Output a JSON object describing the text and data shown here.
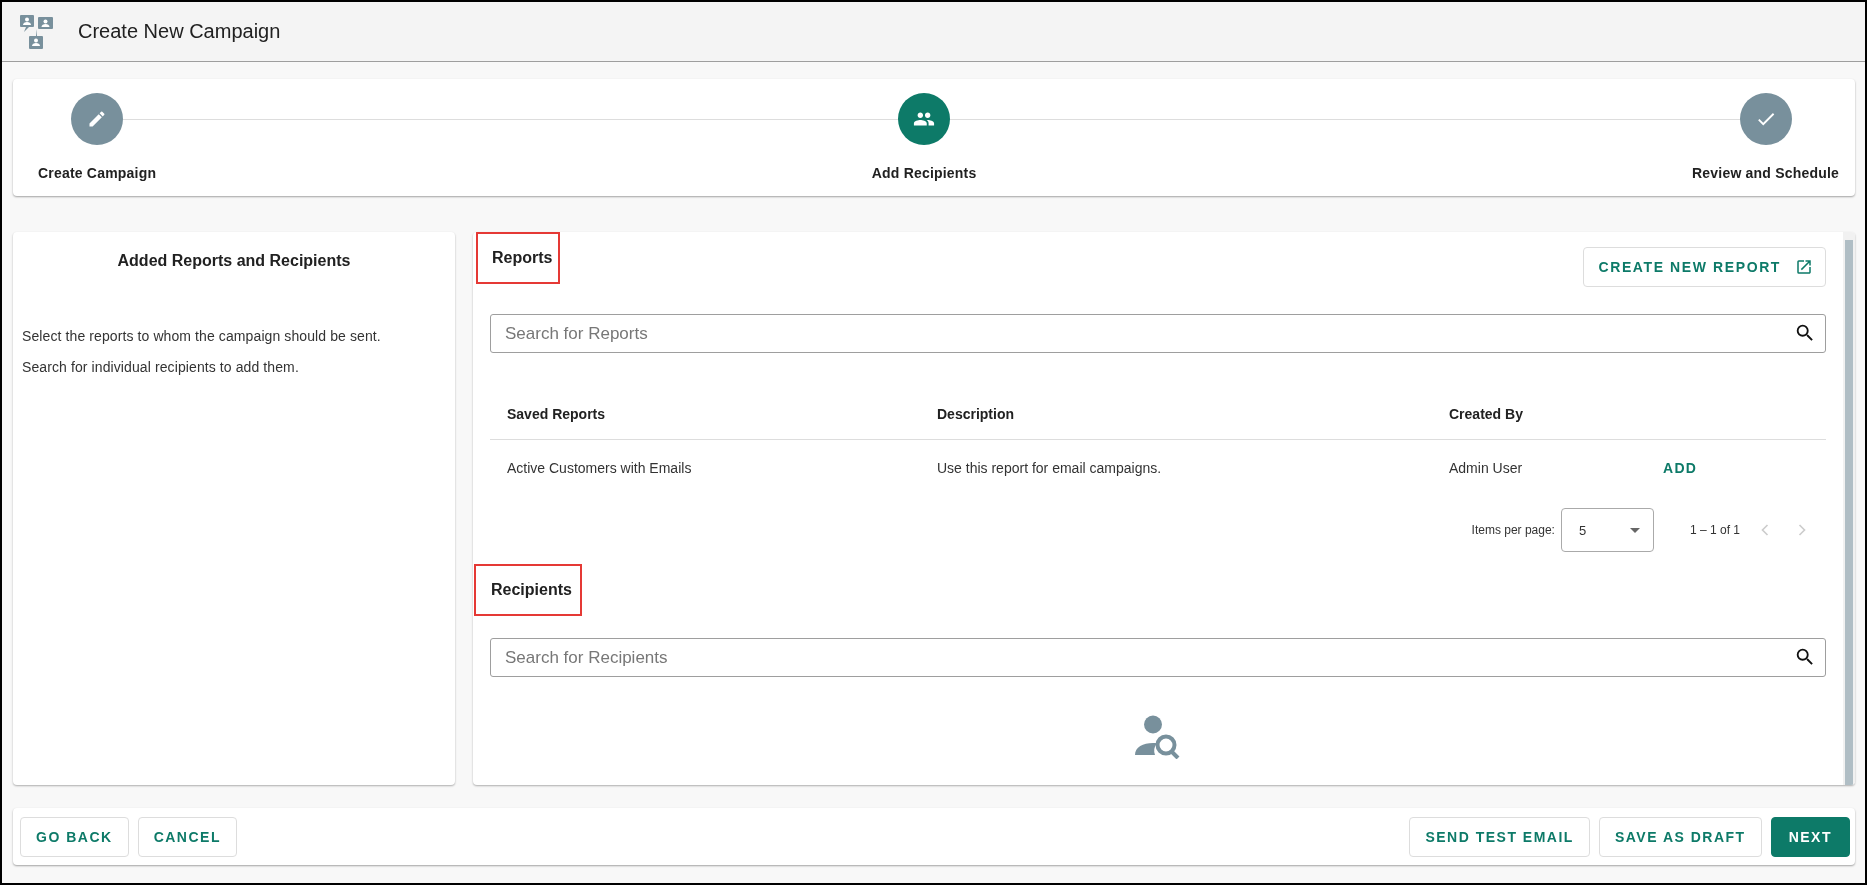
{
  "header": {
    "title": "Create New Campaign"
  },
  "steps": [
    {
      "label": "Create Campaign",
      "kind": "edit",
      "selected": false
    },
    {
      "label": "Add Recipients",
      "kind": "people",
      "selected": true
    },
    {
      "label": "Review and Schedule",
      "kind": "check",
      "selected": false
    }
  ],
  "side_panel": {
    "title": "Added Reports and Recipients",
    "paragraphs": [
      "Select the reports to whom the campaign should be sent.",
      "Search for individual recipients to add them."
    ]
  },
  "reports": {
    "title": "Reports",
    "highlighted": true,
    "create_button": "CREATE NEW REPORT",
    "search": {
      "placeholder": "Search for Reports"
    },
    "table": {
      "columns": [
        "Saved Reports",
        "Description",
        "Created By"
      ],
      "rows": [
        {
          "cells": [
            "Active Customers with Emails",
            "Use this report for email campaigns.",
            "Admin User"
          ],
          "action": "ADD"
        }
      ]
    },
    "paginator": {
      "label": "Items per page:",
      "page_size": "5",
      "range": "1 – 1 of 1",
      "prev_disabled": true,
      "next_disabled": true
    }
  },
  "recipients": {
    "title": "Recipients",
    "highlighted": true,
    "search": {
      "placeholder": "Search for Recipients"
    }
  },
  "footer": {
    "left_buttons": [
      {
        "label": "GO BACK",
        "kind": "outlined"
      },
      {
        "label": "CANCEL",
        "kind": "outlined"
      }
    ],
    "right_buttons": [
      {
        "label": "SEND TEST EMAIL",
        "kind": "outlined"
      },
      {
        "label": "SAVE AS DRAFT",
        "kind": "outlined"
      },
      {
        "label": "NEXT",
        "kind": "filled"
      }
    ]
  }
}
